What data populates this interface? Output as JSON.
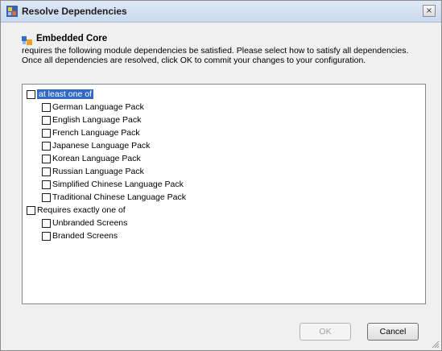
{
  "window": {
    "title": "Resolve Dependencies",
    "close_label": "×"
  },
  "header": {
    "module_name": "Embedded Core",
    "description_line1": "requires the following module dependencies be satisfied. Please select how to satisfy all dependencies.",
    "description_line2": "Once all dependencies are resolved, click OK to commit your changes to your configuration."
  },
  "tree": {
    "groups": [
      {
        "label": "at least one of",
        "checked": false,
        "items": [
          {
            "label": "German Language Pack",
            "checked": false
          },
          {
            "label": "English Language Pack",
            "checked": false
          },
          {
            "label": "French Language Pack",
            "checked": false
          },
          {
            "label": "Japanese Language Pack",
            "checked": false
          },
          {
            "label": "Korean Language Pack",
            "checked": false
          },
          {
            "label": "Russian Language Pack",
            "checked": false
          },
          {
            "label": "Simplified Chinese Language Pack",
            "checked": false
          },
          {
            "label": "Traditional Chinese Language Pack",
            "checked": false
          }
        ]
      },
      {
        "label": "Requires exactly one of",
        "checked": false,
        "items": [
          {
            "label": "Unbranded Screens",
            "checked": false
          },
          {
            "label": "Branded Screens",
            "checked": false
          }
        ]
      }
    ]
  },
  "buttons": {
    "ok_label": "OK",
    "ok_enabled": false,
    "cancel_label": "Cancel"
  },
  "colors": {
    "selection": "#3169c6",
    "titlebar": "#c9d9ee"
  }
}
